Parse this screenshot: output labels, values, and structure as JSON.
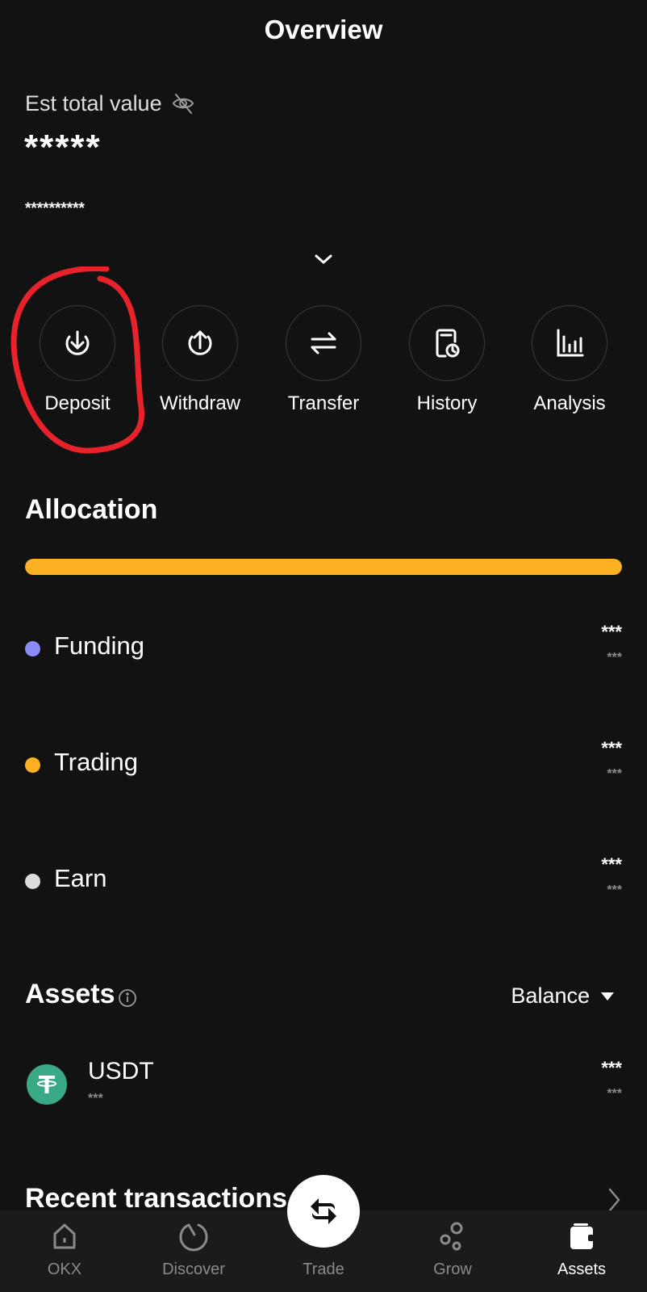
{
  "header": {
    "title": "Overview"
  },
  "summary": {
    "est_label": "Est total value",
    "total_value": "*****",
    "sub_value": "**********"
  },
  "actions": [
    {
      "label": "Deposit",
      "icon": "deposit-icon"
    },
    {
      "label": "Withdraw",
      "icon": "withdraw-icon"
    },
    {
      "label": "Transfer",
      "icon": "transfer-icon"
    },
    {
      "label": "History",
      "icon": "history-icon"
    },
    {
      "label": "Analysis",
      "icon": "analysis-icon"
    }
  ],
  "annotation": {
    "highlighted_action": "Deposit",
    "color": "#e8222a"
  },
  "allocation": {
    "title": "Allocation",
    "bar_fill_percent": 100,
    "bar_color": "#fdb022",
    "accounts": [
      {
        "name": "Funding",
        "color": "#8b8cf8",
        "value": "***",
        "sub_value": "***"
      },
      {
        "name": "Trading",
        "color": "#fdb022",
        "value": "***",
        "sub_value": "***"
      },
      {
        "name": "Earn",
        "color": "#dcdcdc",
        "value": "***",
        "sub_value": "***"
      }
    ]
  },
  "assets": {
    "title": "Assets",
    "sort_label": "Balance",
    "items": [
      {
        "symbol": "USDT",
        "sub": "***",
        "value": "***",
        "sub_value": "***",
        "color": "#3aa988"
      }
    ]
  },
  "recent": {
    "title": "Recent transactions"
  },
  "tabbar": {
    "tabs": [
      {
        "label": "OKX",
        "active": false
      },
      {
        "label": "Discover",
        "active": false
      },
      {
        "label": "Trade",
        "active": false
      },
      {
        "label": "Grow",
        "active": false
      },
      {
        "label": "Assets",
        "active": true
      }
    ]
  }
}
